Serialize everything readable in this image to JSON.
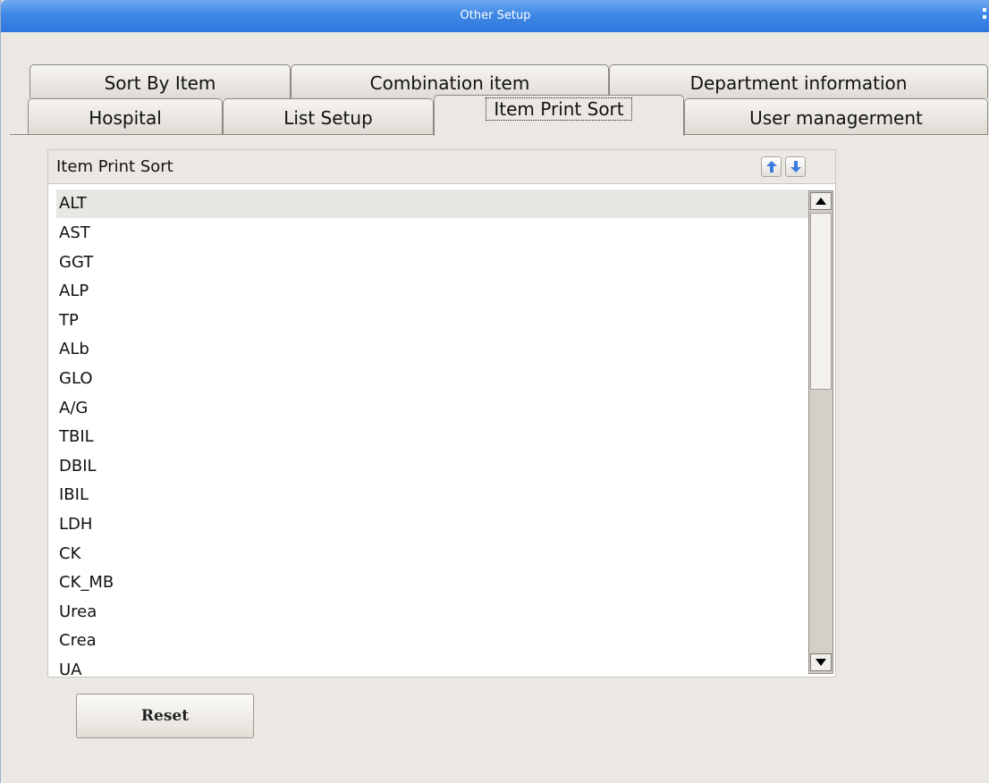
{
  "window": {
    "title": "Other Setup"
  },
  "tabs": {
    "row1": [
      "Sort By Item",
      "Combination item",
      "Department information"
    ],
    "row2": [
      "Hospital",
      "List Setup",
      "Item Print Sort",
      "User managerment"
    ],
    "active": "Item Print Sort"
  },
  "list": {
    "header": "Item Print Sort",
    "up_icon": "up-arrow-icon",
    "down_icon": "down-arrow-icon",
    "selected_item": "ALT",
    "items": [
      "ALT",
      "AST",
      "GGT",
      "ALP",
      "TP",
      "ALb",
      "GLO",
      "A/G",
      "TBIL",
      "DBIL",
      "IBIL",
      "LDH",
      "CK",
      "CK_MB",
      "Urea",
      "Crea",
      "UA"
    ]
  },
  "buttons": {
    "reset": "Reset"
  },
  "colors": {
    "titlebar": "#3f88e6",
    "arrow_blue": "#3b7be0"
  }
}
